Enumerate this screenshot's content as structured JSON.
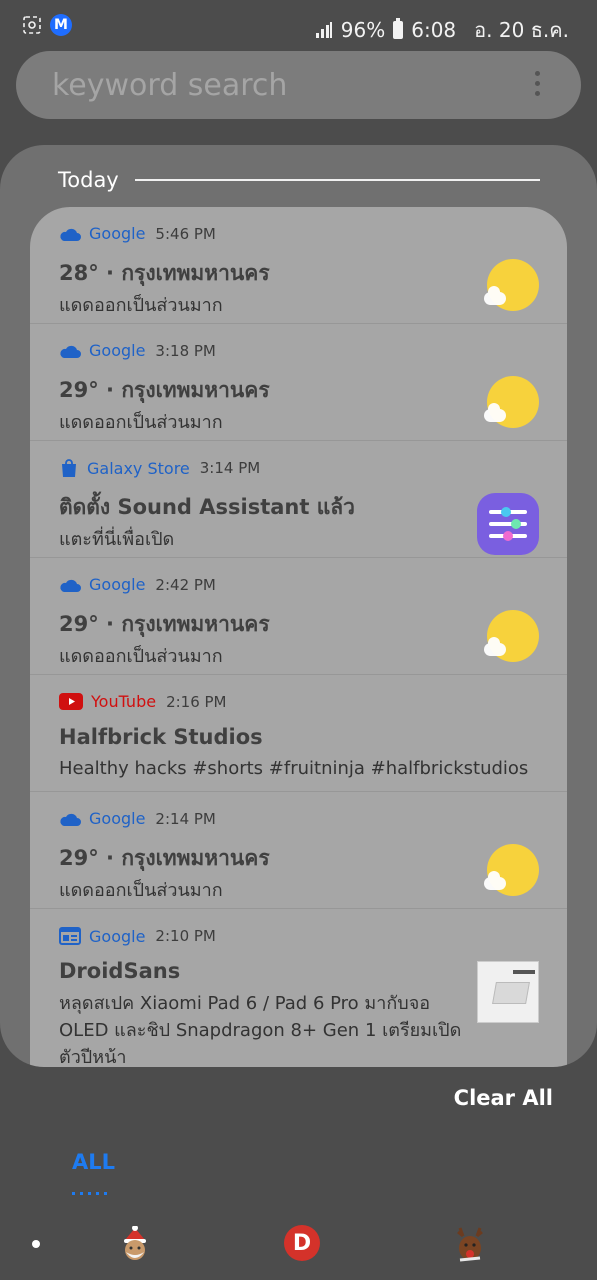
{
  "status_bar": {
    "battery": "96%",
    "time": "6:08",
    "date": "อ. 20 ธ.ค."
  },
  "search": {
    "placeholder": "keyword search"
  },
  "section": {
    "today_label": "Today"
  },
  "notifications": [
    {
      "app": "Google",
      "time": "5:46 PM",
      "title": "28° · กรุงเทพมหานคร",
      "body": "แดดออกเป็นส่วนมาก",
      "icon": "cloud-icon",
      "thumb": "partly-sunny-icon"
    },
    {
      "app": "Google",
      "time": "3:18 PM",
      "title": "29° · กรุงเทพมหานคร",
      "body": "แดดออกเป็นส่วนมาก",
      "icon": "cloud-icon",
      "thumb": "partly-sunny-icon"
    },
    {
      "app": "Galaxy Store",
      "time": "3:14 PM",
      "title": "ติดตั้ง Sound Assistant แล้ว",
      "body": "แตะที่นี่เพื่อเปิด",
      "icon": "shopping-bag-icon",
      "thumb": "sound-assistant-app-icon"
    },
    {
      "app": "Google",
      "time": "2:42 PM",
      "title": "29° · กรุงเทพมหานคร",
      "body": "แดดออกเป็นส่วนมาก",
      "icon": "cloud-icon",
      "thumb": "partly-sunny-icon"
    },
    {
      "app": "YouTube",
      "time": "2:16 PM",
      "title": "Halfbrick Studios",
      "body": "Healthy hacks #shorts #fruitninja #halfbrickstudios",
      "icon": "youtube-icon"
    },
    {
      "app": "Google",
      "time": "2:14 PM",
      "title": "29° · กรุงเทพมหานคร",
      "body": "แดดออกเป็นส่วนมาก",
      "icon": "cloud-icon",
      "thumb": "partly-sunny-icon"
    },
    {
      "app": "Google",
      "time": "2:10 PM",
      "title": "DroidSans",
      "body": "หลุดสเปค Xiaomi Pad 6 / Pad 6 Pro มากับจอ OLED และชิป Snapdragon 8+ Gen 1 เตรียมเปิดตัวปีหน้า",
      "icon": "news-icon",
      "thumb": "article-thumbnail"
    }
  ],
  "actions": {
    "clear_all": "Clear All"
  },
  "tabs": {
    "all": "ALL"
  },
  "colors": {
    "accent": "#1e7bf0",
    "google_blue": "#1f62c7",
    "youtube_red": "#d01010",
    "sun_yellow": "#f7d23c"
  }
}
